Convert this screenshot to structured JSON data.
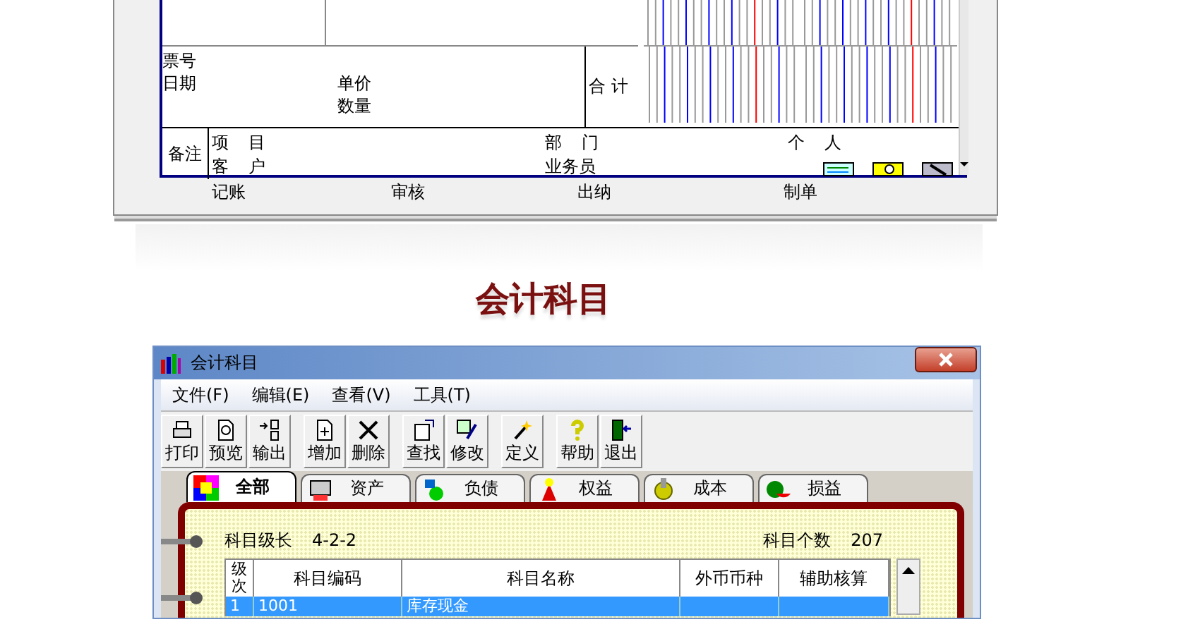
{
  "voucher": {
    "id_labels": [
      "票号",
      "日期"
    ],
    "price_labels": [
      "单价",
      "数量"
    ],
    "total_label": "合 计",
    "remarks_label": "备注",
    "remark_groups": [
      [
        "项 目",
        "客 户"
      ],
      [
        "部 门",
        "业务员"
      ],
      [
        "个 人"
      ]
    ],
    "signatures": [
      "记账",
      "审核",
      "出纳",
      "制单"
    ]
  },
  "heading": "会计科目",
  "window": {
    "title": "会计科目"
  },
  "menu": [
    "文件(F)",
    "编辑(E)",
    "查看(V)",
    "工具(T)"
  ],
  "toolbar": [
    [
      "打印",
      "预览",
      "输出"
    ],
    [
      "增加",
      "删除"
    ],
    [
      "查找",
      "修改"
    ],
    [
      "定义"
    ],
    [
      "帮助",
      "退出"
    ]
  ],
  "tabs": [
    {
      "label": "全部",
      "selected": true
    },
    {
      "label": "资产",
      "selected": false
    },
    {
      "label": "负债",
      "selected": false
    },
    {
      "label": "权益",
      "selected": false
    },
    {
      "label": "成本",
      "selected": false
    },
    {
      "label": "损益",
      "selected": false
    }
  ],
  "info": {
    "level_label": "科目级长",
    "level_value": "4-2-2",
    "count_label": "科目个数",
    "count_value": "207"
  },
  "table": {
    "columns": [
      "级次",
      "科目编码",
      "科目名称",
      "外币币种",
      "辅助核算"
    ],
    "rows": [
      {
        "cells": [
          "1",
          "1001",
          "库存现金"
        ],
        "selected": true
      }
    ]
  }
}
